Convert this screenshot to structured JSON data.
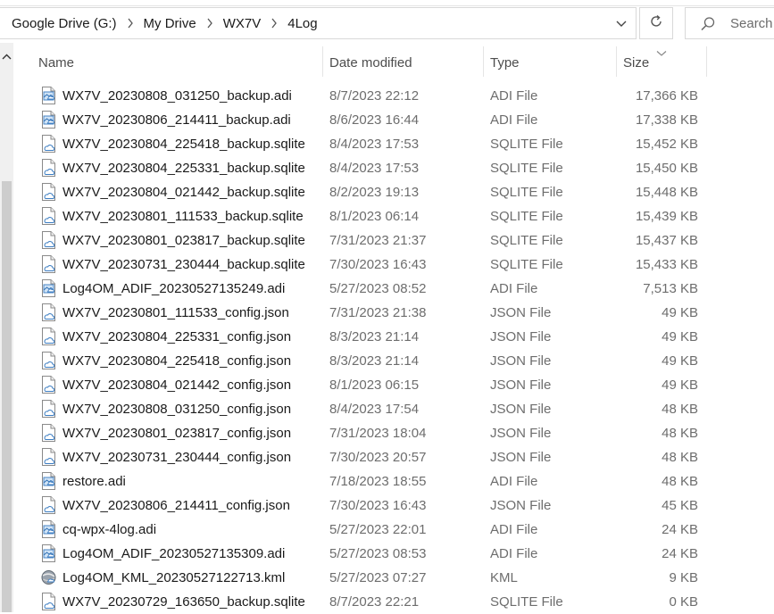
{
  "breadcrumb": [
    "Google Drive (G:)",
    "My Drive",
    "WX7V",
    "4Log"
  ],
  "search": {
    "placeholder": "Search"
  },
  "columns": {
    "name": "Name",
    "date": "Date modified",
    "type": "Type",
    "size": "Size"
  },
  "files": [
    {
      "name": "WX7V_20230808_031250_backup.adi",
      "date": "8/7/2023 22:12",
      "type": "ADI File",
      "size": "17,366 KB",
      "icon": "adi-file-icon"
    },
    {
      "name": "WX7V_20230806_214411_backup.adi",
      "date": "8/6/2023 16:44",
      "type": "ADI File",
      "size": "17,338 KB",
      "icon": "adi-file-icon"
    },
    {
      "name": "WX7V_20230804_225418_backup.sqlite",
      "date": "8/4/2023 17:53",
      "type": "SQLITE File",
      "size": "15,452 KB",
      "icon": "cloud-file-icon"
    },
    {
      "name": "WX7V_20230804_225331_backup.sqlite",
      "date": "8/4/2023 17:53",
      "type": "SQLITE File",
      "size": "15,450 KB",
      "icon": "cloud-file-icon"
    },
    {
      "name": "WX7V_20230804_021442_backup.sqlite",
      "date": "8/2/2023 19:13",
      "type": "SQLITE File",
      "size": "15,448 KB",
      "icon": "cloud-file-icon"
    },
    {
      "name": "WX7V_20230801_111533_backup.sqlite",
      "date": "8/1/2023 06:14",
      "type": "SQLITE File",
      "size": "15,439 KB",
      "icon": "cloud-file-icon"
    },
    {
      "name": "WX7V_20230801_023817_backup.sqlite",
      "date": "7/31/2023 21:37",
      "type": "SQLITE File",
      "size": "15,437 KB",
      "icon": "cloud-file-icon"
    },
    {
      "name": "WX7V_20230731_230444_backup.sqlite",
      "date": "7/30/2023 16:43",
      "type": "SQLITE File",
      "size": "15,433 KB",
      "icon": "cloud-file-icon"
    },
    {
      "name": "Log4OM_ADIF_20230527135249.adi",
      "date": "5/27/2023 08:52",
      "type": "ADI File",
      "size": "7,513 KB",
      "icon": "adi-file-icon"
    },
    {
      "name": "WX7V_20230801_111533_config.json",
      "date": "7/31/2023 21:38",
      "type": "JSON File",
      "size": "49 KB",
      "icon": "json-file-icon"
    },
    {
      "name": "WX7V_20230804_225331_config.json",
      "date": "8/3/2023 21:14",
      "type": "JSON File",
      "size": "49 KB",
      "icon": "json-file-icon"
    },
    {
      "name": "WX7V_20230804_225418_config.json",
      "date": "8/3/2023 21:14",
      "type": "JSON File",
      "size": "49 KB",
      "icon": "json-file-icon"
    },
    {
      "name": "WX7V_20230804_021442_config.json",
      "date": "8/1/2023 06:15",
      "type": "JSON File",
      "size": "49 KB",
      "icon": "json-file-icon"
    },
    {
      "name": "WX7V_20230808_031250_config.json",
      "date": "8/4/2023 17:54",
      "type": "JSON File",
      "size": "48 KB",
      "icon": "json-file-icon"
    },
    {
      "name": "WX7V_20230801_023817_config.json",
      "date": "7/31/2023 18:04",
      "type": "JSON File",
      "size": "48 KB",
      "icon": "json-file-icon"
    },
    {
      "name": "WX7V_20230731_230444_config.json",
      "date": "7/30/2023 20:57",
      "type": "JSON File",
      "size": "48 KB",
      "icon": "json-file-icon"
    },
    {
      "name": "restore.adi",
      "date": "7/18/2023 18:55",
      "type": "ADI File",
      "size": "48 KB",
      "icon": "adi-file-icon"
    },
    {
      "name": "WX7V_20230806_214411_config.json",
      "date": "7/30/2023 16:43",
      "type": "JSON File",
      "size": "45 KB",
      "icon": "json-file-icon"
    },
    {
      "name": "cq-wpx-4log.adi",
      "date": "5/27/2023 22:01",
      "type": "ADI File",
      "size": "24 KB",
      "icon": "adi-file-icon"
    },
    {
      "name": "Log4OM_ADIF_20230527135309.adi",
      "date": "5/27/2023 08:53",
      "type": "ADI File",
      "size": "24 KB",
      "icon": "adi-file-icon"
    },
    {
      "name": "Log4OM_KML_20230527122713.kml",
      "date": "5/27/2023 07:27",
      "type": "KML",
      "size": "9 KB",
      "icon": "kml-file-icon"
    },
    {
      "name": "WX7V_20230729_163650_backup.sqlite",
      "date": "8/7/2023 22:21",
      "type": "SQLITE File",
      "size": "0 KB",
      "icon": "cloud-file-icon"
    }
  ]
}
